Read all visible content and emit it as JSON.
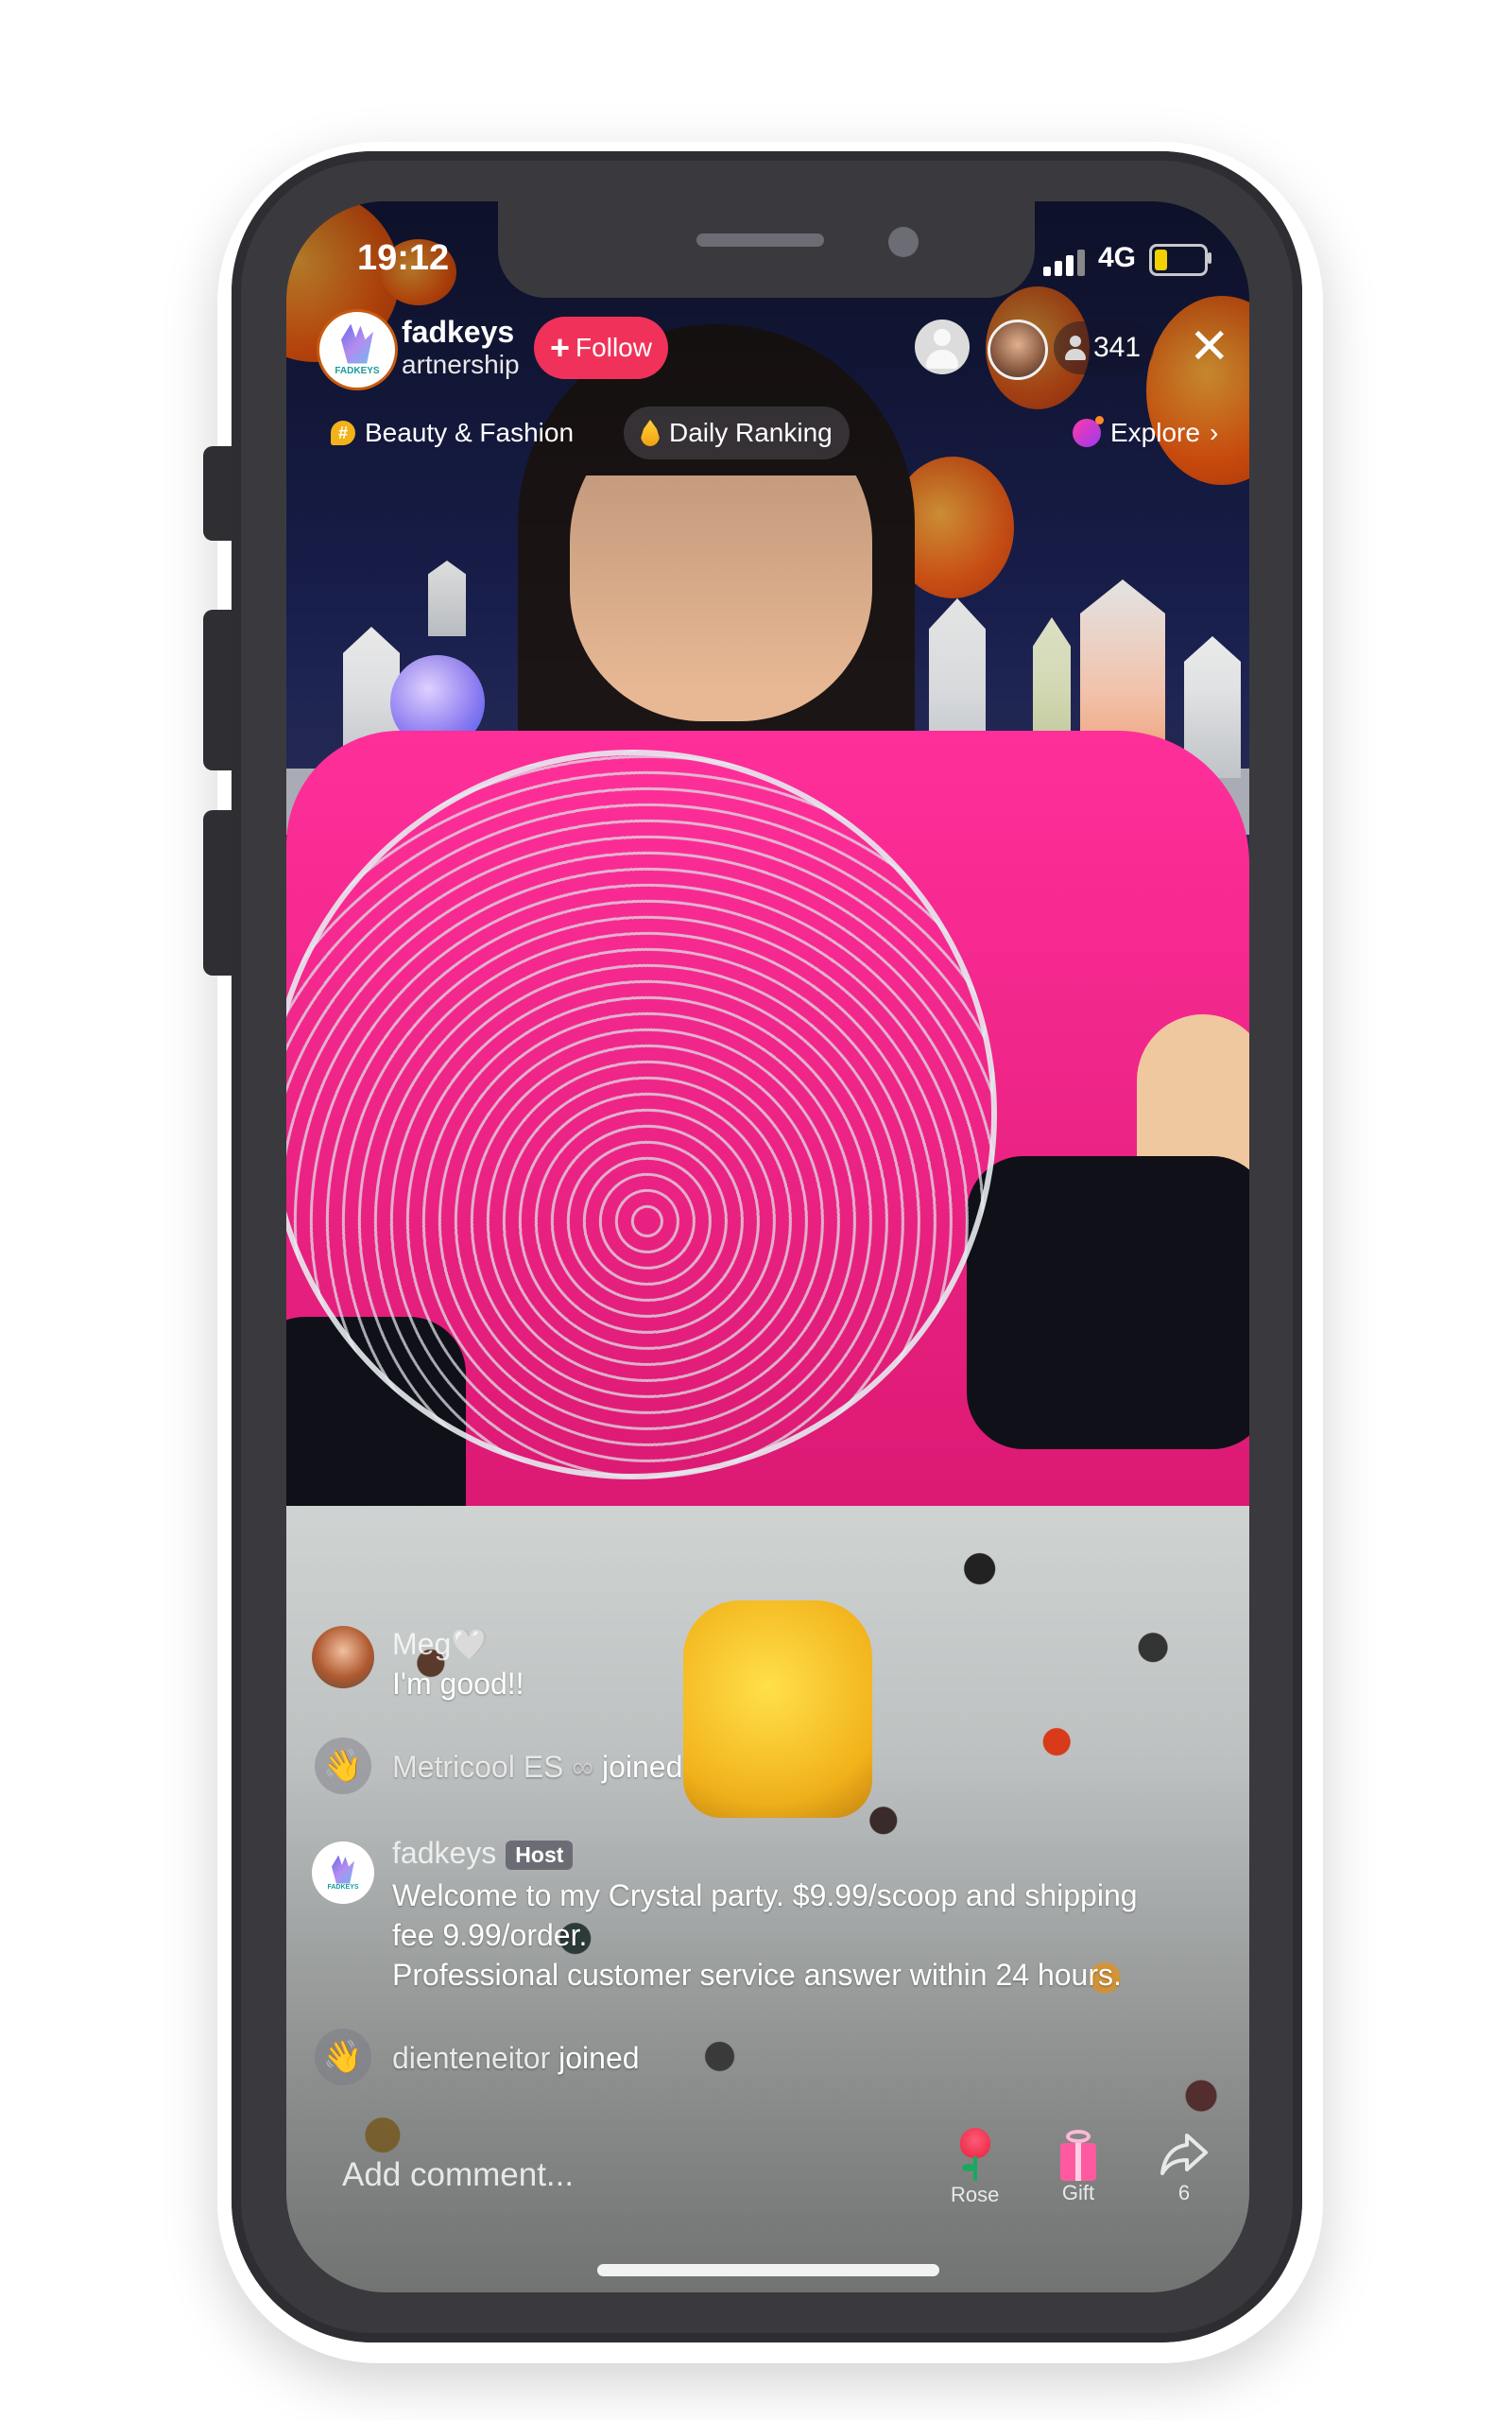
{
  "status_bar": {
    "time": "19:12",
    "network": "4G",
    "battery_level_fraction": 0.25,
    "battery_color": "#f3d000"
  },
  "header": {
    "host_name": "fadkeys",
    "host_subtitle": "artnership",
    "host_avatar_text": "FADKEYS",
    "follow_label": "Follow",
    "follow_color": "#f0325a",
    "viewer_count": "341",
    "close_icon": "close-icon"
  },
  "categories": [
    {
      "label": "Beauty & Fashion",
      "icon": "hashtag-icon"
    },
    {
      "label": "Daily Ranking",
      "icon": "flame-icon"
    },
    {
      "label": "Explore",
      "icon": "planet-icon",
      "chevron": "›"
    }
  ],
  "comments": [
    {
      "type": "comment",
      "user": "Meg",
      "suffix": "🤍",
      "text": "I'm good!!"
    },
    {
      "type": "join",
      "user": "Metricool ES",
      "suffix": "∞",
      "text": "joined"
    },
    {
      "type": "host",
      "user": "fadkeys",
      "badge": "Host",
      "lines": [
        "Welcome to my Crystal party. $9.99/scoop and shipping",
        "fee 9.99/order.",
        "Professional customer service answer within 24 hours."
      ]
    },
    {
      "type": "join",
      "user": "dienteneitor",
      "text": "joined"
    }
  ],
  "bottom_bar": {
    "comment_placeholder": "Add comment...",
    "rose_label": "Rose",
    "gift_label": "Gift",
    "share_count": "6"
  }
}
